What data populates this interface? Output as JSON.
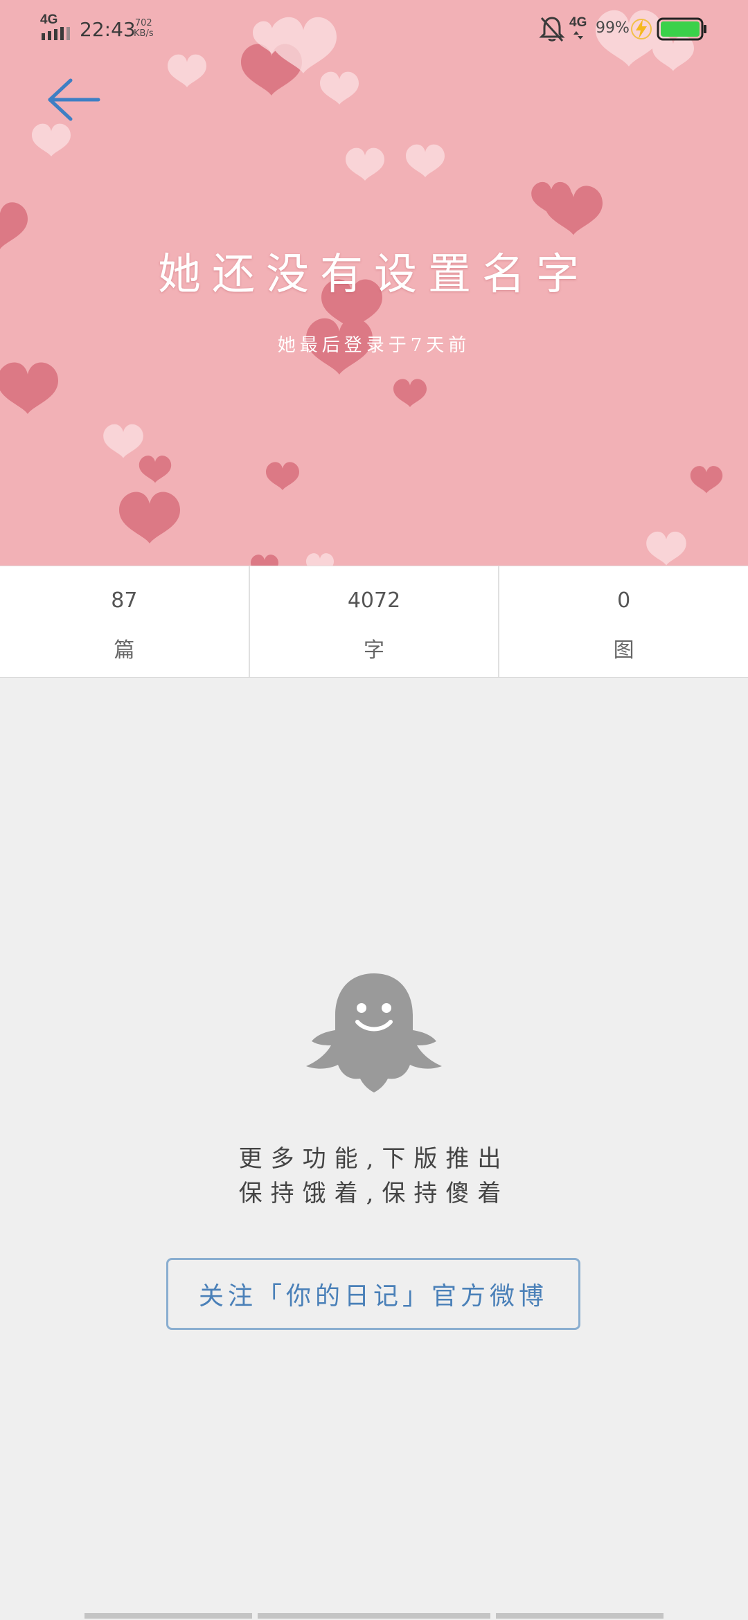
{
  "status_bar": {
    "network": "4G",
    "time": "22:43",
    "speed_value": "702",
    "speed_unit": "KB/s",
    "network2": "4G",
    "battery_percent": "99%"
  },
  "header": {
    "title": "她还没有设置名字",
    "subtitle": "她最后登录于7天前",
    "background_color": "#f2b1b6"
  },
  "stats": [
    {
      "value": "87",
      "label": "篇"
    },
    {
      "value": "4072",
      "label": "字"
    },
    {
      "value": "0",
      "label": "图"
    }
  ],
  "empty_state": {
    "line1": "更多功能,下版推出",
    "line2": "保持饿着,保持傻着",
    "icon": "ghost-icon"
  },
  "follow_button": {
    "label": "关注「你的日记」官方微博",
    "accent": "#4a80b8"
  }
}
